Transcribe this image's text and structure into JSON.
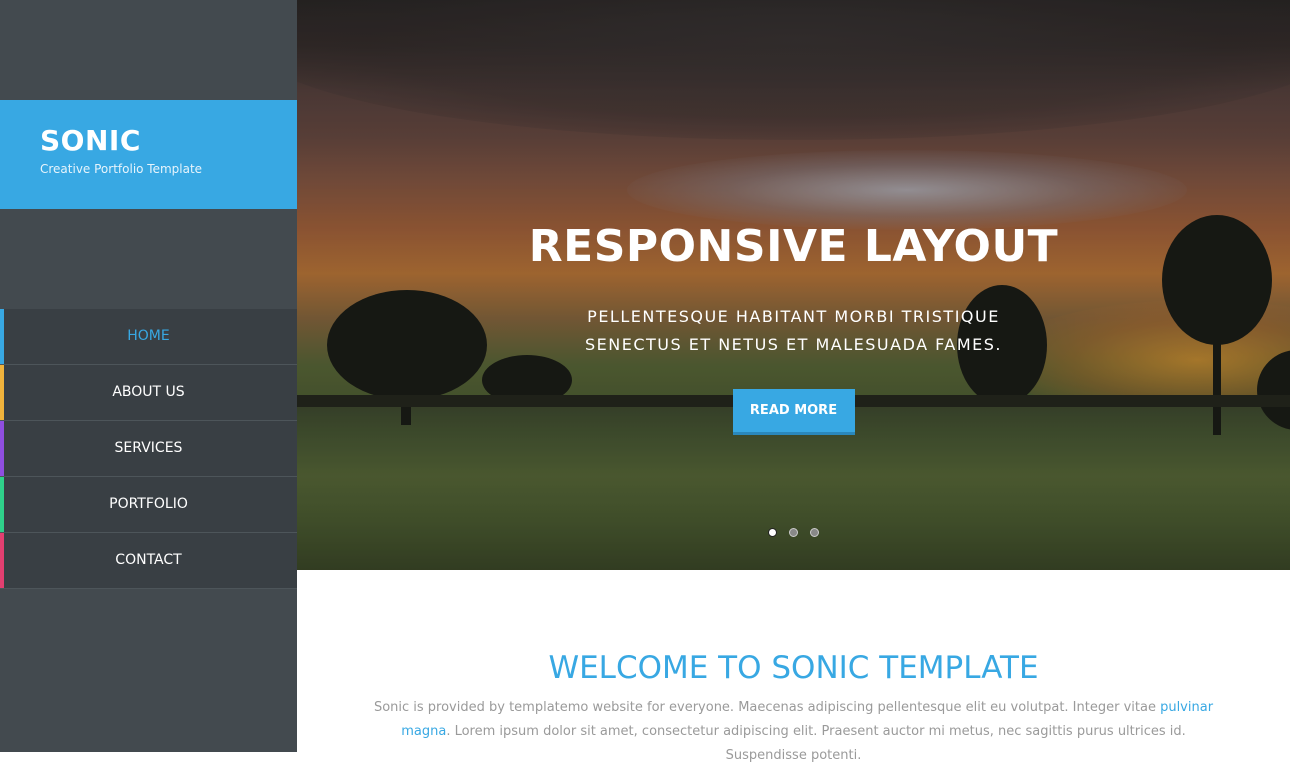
{
  "brand": {
    "title": "SONIC",
    "subtitle": "Creative Portfolio Template"
  },
  "nav": {
    "items": [
      {
        "label": "HOME",
        "accent": "#38a8e3",
        "active": true
      },
      {
        "label": "ABOUT US",
        "accent": "#f0b33c"
      },
      {
        "label": "SERVICES",
        "accent": "#8f4ee0"
      },
      {
        "label": "PORTFOLIO",
        "accent": "#2fd08a"
      },
      {
        "label": "CONTACT",
        "accent": "#e23f70"
      }
    ]
  },
  "hero": {
    "title": "RESPONSIVE LAYOUT",
    "subtitle": "PELLENTESQUE HABITANT MORBI TRISTIQUE SENECTUS ET NETUS ET MALESUADA FAMES.",
    "button_label": "READ MORE",
    "slides": {
      "count": 3,
      "active_index": 0
    }
  },
  "welcome": {
    "title": "WELCOME TO SONIC TEMPLATE",
    "text_before_link": "Sonic is provided by templatemo website for everyone. Maecenas adipiscing pellentesque elit eu volutpat. Integer vitae ",
    "link_text": "pulvinar magna",
    "text_after_link": ". Lorem ipsum dolor sit amet, consectetur adipiscing elit. Praesent auctor mi metus, nec sagittis purus ultrices id. Suspendisse potenti."
  },
  "colors": {
    "accent": "#38a8e3",
    "sidebar_bg": "#434a4f",
    "nav_bg": "#393f44"
  }
}
